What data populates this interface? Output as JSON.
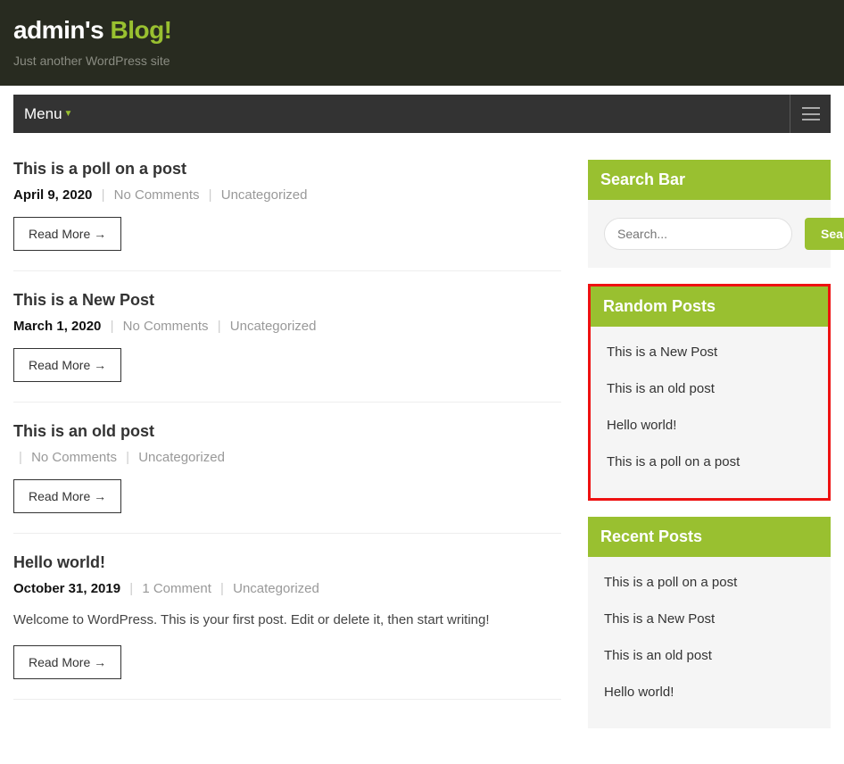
{
  "header": {
    "title_prefix": "admin's ",
    "title_accent": "Blog!",
    "tagline": "Just another WordPress site"
  },
  "nav": {
    "menu_label": "Menu"
  },
  "posts": [
    {
      "title": "This is a poll on a post",
      "date": "April 9, 2020",
      "comments": "No Comments",
      "category": "Uncategorized",
      "excerpt": "",
      "read_more": "Read More"
    },
    {
      "title": "This is a New Post",
      "date": "March 1, 2020",
      "comments": "No Comments",
      "category": "Uncategorized",
      "excerpt": "",
      "read_more": "Read More"
    },
    {
      "title": "This is an old post",
      "date": "",
      "comments": "No Comments",
      "category": "Uncategorized",
      "excerpt": "",
      "read_more": "Read More"
    },
    {
      "title": "Hello world!",
      "date": "October 31, 2019",
      "comments": "1 Comment",
      "category": "Uncategorized",
      "excerpt": "Welcome to WordPress. This is your first post. Edit or delete it, then start writing!",
      "read_more": "Read More"
    }
  ],
  "sidebar": {
    "search": {
      "title": "Search Bar",
      "placeholder": "Search...",
      "button": "Search"
    },
    "random": {
      "title": "Random Posts",
      "items": [
        "This is a New Post",
        "This is an old post",
        "Hello world!",
        "This is a poll on a post"
      ]
    },
    "recent": {
      "title": "Recent Posts",
      "items": [
        "This is a poll on a post",
        "This is a New Post",
        "This is an old post",
        "Hello world!"
      ]
    }
  },
  "colors": {
    "accent": "#99c030",
    "header_bg": "#282b20",
    "nav_bg": "#333333"
  }
}
